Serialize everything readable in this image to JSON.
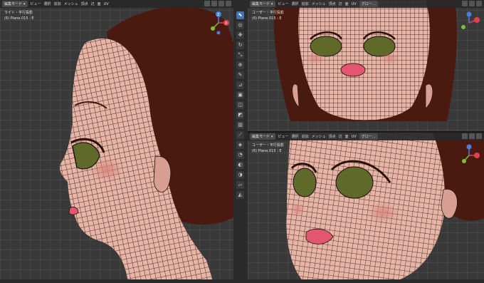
{
  "viewport_left": {
    "mode_label": "編集モード",
    "menus": [
      "ビュー",
      "選択",
      "追加",
      "メッシュ",
      "頂点",
      "辺",
      "面",
      "UV"
    ],
    "view_name": "ライト・平行投影",
    "object_name": "(6) Plane.015 : E"
  },
  "viewport_top_right": {
    "mode_label": "編集モード",
    "menus": [
      "ビュー",
      "選択",
      "追加",
      "メッシュ",
      "頂点",
      "辺",
      "面",
      "UV"
    ],
    "orientation_label": "グロー…",
    "view_name": "ユーザー・平行投影",
    "object_name": "(6) Plane.015 : E"
  },
  "viewport_bottom_right": {
    "mode_label": "編集モード",
    "menus": [
      "ビュー",
      "選択",
      "追加",
      "メッシュ",
      "頂点",
      "辺",
      "面",
      "UV"
    ],
    "orientation_label": "グロー…",
    "view_name": "ユーザー・平行投影",
    "object_name": "(6) Plane.015 : E"
  },
  "gizmo_axes": {
    "x": "X",
    "y": "Y",
    "z": "Z"
  },
  "tool_icons": [
    "select-tool-icon",
    "cursor-tool-icon",
    "move-tool-icon",
    "rotate-tool-icon",
    "scale-tool-icon",
    "transform-tool-icon",
    "annotate-tool-icon",
    "measure-tool-icon",
    "extrude-tool-icon",
    "inset-tool-icon",
    "bevel-tool-icon",
    "loopcut-tool-icon",
    "knife-tool-icon",
    "polybuild-tool-icon",
    "spin-tool-icon",
    "smooth-tool-icon",
    "shrink-tool-icon",
    "shear-tool-icon",
    "rip-tool-icon"
  ],
  "colors": {
    "viewport_bg": "#393939",
    "header_bg": "#282828",
    "hair": "#4a1a10",
    "skin": "#e7b4a6",
    "blush": "#d9837a",
    "lips": "#e3566f",
    "eye_green": "#5f6a2a",
    "wire": "#1b0d0d",
    "active_tool": "#4772b3"
  }
}
